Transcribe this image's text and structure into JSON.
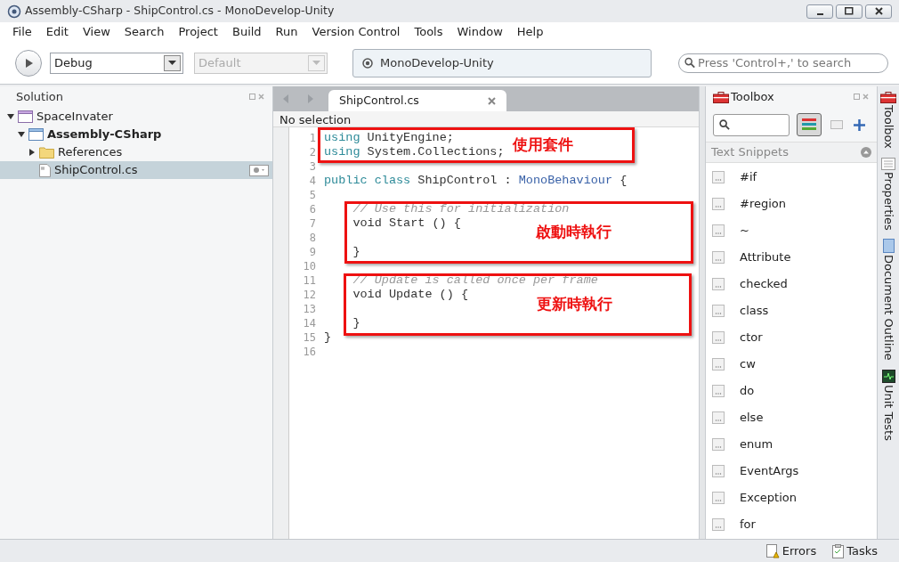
{
  "window": {
    "title": "Assembly-CSharp - ShipControl.cs - MonoDevelop-Unity"
  },
  "menu": [
    "File",
    "Edit",
    "View",
    "Search",
    "Project",
    "Build",
    "Run",
    "Version Control",
    "Tools",
    "Window",
    "Help"
  ],
  "toolbar": {
    "configuration": "Debug",
    "platform": {
      "value": "Default",
      "disabled": true
    },
    "status": "MonoDevelop-Unity",
    "search": {
      "placeholder": "Press 'Control+,' to search"
    }
  },
  "solution": {
    "title": "Solution",
    "tree": [
      {
        "label": "SpaceInvater",
        "kind": "solution",
        "expanded": true,
        "selected": false,
        "children": [
          {
            "label": "Assembly-CSharp",
            "kind": "project",
            "expanded": true,
            "selected": false,
            "children": [
              {
                "label": "References",
                "kind": "folder",
                "expanded": false,
                "selected": false
              },
              {
                "label": "ShipControl.cs",
                "kind": "file",
                "selected": true
              }
            ]
          }
        ]
      }
    ]
  },
  "editor": {
    "tab": {
      "label": "ShipControl.cs"
    },
    "breadcrumb": "No selection",
    "lines": [
      {
        "number": "1",
        "tokens": [
          {
            "kind": "keyword",
            "text": "using"
          },
          {
            "kind": "plain",
            "text": " UnityEngine;"
          }
        ]
      },
      {
        "number": "2",
        "tokens": [
          {
            "kind": "keyword",
            "text": "using"
          },
          {
            "kind": "plain",
            "text": " System.Collections;"
          }
        ]
      },
      {
        "number": "3"
      },
      {
        "number": "4",
        "tokens": [
          {
            "kind": "keyword",
            "text": "public class"
          },
          {
            "kind": "plain",
            "text": " ShipControl : "
          },
          {
            "kind": "type",
            "text": "MonoBehaviour"
          },
          {
            "kind": "plain",
            "text": " {"
          }
        ]
      },
      {
        "number": "5"
      },
      {
        "number": "6",
        "tokens": [
          {
            "kind": "comment",
            "text": "    // Use this for initialization"
          }
        ]
      },
      {
        "number": "7",
        "tokens": [
          {
            "kind": "plain",
            "text": "    void Start () {"
          }
        ]
      },
      {
        "number": "8"
      },
      {
        "number": "9",
        "tokens": [
          {
            "kind": "plain",
            "text": "    }"
          }
        ]
      },
      {
        "number": "10"
      },
      {
        "number": "11",
        "tokens": [
          {
            "kind": "comment",
            "text": "    // Update is called once per frame"
          }
        ]
      },
      {
        "number": "12",
        "tokens": [
          {
            "kind": "plain",
            "text": "    void Update () {"
          }
        ]
      },
      {
        "number": "13"
      },
      {
        "number": "14",
        "tokens": [
          {
            "kind": "plain",
            "text": "    }"
          }
        ]
      },
      {
        "number": "15",
        "tokens": [
          {
            "kind": "plain",
            "text": "}"
          }
        ]
      },
      {
        "number": "16"
      }
    ],
    "annotations": [
      {
        "text": "使用套件"
      },
      {
        "text": "啟動時執行"
      },
      {
        "text": "更新時執行"
      }
    ]
  },
  "toolbox": {
    "title": "Toolbox",
    "section": "Text Snippets",
    "items": [
      "#if",
      "#region",
      "~",
      "Attribute",
      "checked",
      "class",
      "ctor",
      "cw",
      "do",
      "else",
      "enum",
      "EventArgs",
      "Exception",
      "for"
    ]
  },
  "side_tabs": [
    {
      "label": "Toolbox",
      "kind": "toolbox"
    },
    {
      "label": "Properties",
      "kind": "properties"
    },
    {
      "label": "Document Outline",
      "kind": "outline"
    },
    {
      "label": "Unit Tests",
      "kind": "tests"
    }
  ],
  "status_bar": [
    {
      "label": "Errors",
      "kind": "errors"
    },
    {
      "label": "Tasks",
      "kind": "tasks"
    }
  ]
}
